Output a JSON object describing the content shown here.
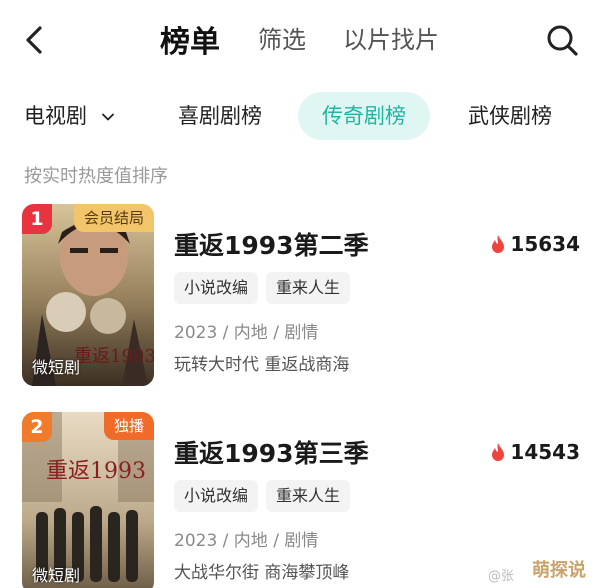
{
  "nav": {
    "tabs": [
      {
        "label": "榜单",
        "active": true
      },
      {
        "label": "筛选",
        "active": false
      },
      {
        "label": "以片找片",
        "active": false
      }
    ]
  },
  "categories": {
    "dropdown_label": "电视剧",
    "items": [
      {
        "label": "喜剧剧榜",
        "active": false
      },
      {
        "label": "传奇剧榜",
        "active": true
      },
      {
        "label": "武侠剧榜",
        "active": false
      }
    ]
  },
  "sort_hint": "按实时热度值排序",
  "items": [
    {
      "rank": "1",
      "corner_tag": "会员结局",
      "poster_label": "微短剧",
      "title": "重返1993第二季",
      "heat": "15634",
      "tags": [
        "小说改编",
        "重来人生"
      ],
      "meta": "2023 / 内地 / 剧情",
      "desc": "玩转大时代 重返战商海"
    },
    {
      "rank": "2",
      "corner_tag": "独播",
      "poster_label": "微短剧",
      "title": "重返1993第三季",
      "heat": "14543",
      "tags": [
        "小说改编",
        "重来人生"
      ],
      "meta": "2023 / 内地 / 剧情",
      "desc": "大战华尔街 商海攀顶峰"
    }
  ],
  "watermark": "萌探说",
  "watermark_user": "@张",
  "colors": {
    "accent": "#22b5a2",
    "accent_bg": "#dff6f2",
    "rank1": "#e8343f",
    "rank2": "#f07b2a",
    "flame": "#f0433d"
  },
  "icons": [
    "back-icon",
    "search-icon",
    "chevron-down-icon",
    "flame-icon"
  ]
}
